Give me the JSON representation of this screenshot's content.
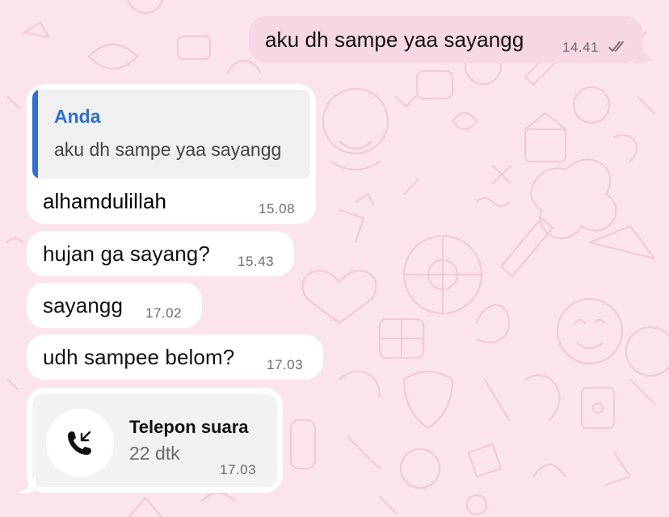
{
  "colors": {
    "background": "#fbe4ec",
    "incoming_bubble": "#ffffff",
    "outgoing_bubble": "#f7d7e4",
    "quote_accent": "#2f6fd0",
    "timestamp": "#6b6b6b"
  },
  "messages": {
    "outgoing_1": {
      "text": "aku dh sampe yaa sayangg",
      "time": "14.41",
      "status_icon": "double-check-icon"
    },
    "reply": {
      "quote_author": "Anda",
      "quote_text": "aku dh sampe yaa sayangg",
      "text": "alhamdulillah",
      "time": "15.08"
    },
    "incoming_2": {
      "text": "hujan ga sayang?",
      "time": "15.43"
    },
    "incoming_3": {
      "text": "sayangg",
      "time": "17.02"
    },
    "incoming_4": {
      "text": "udh sampee belom?",
      "time": "17.03"
    }
  },
  "call": {
    "icon": "incoming-call-icon",
    "title": "Telepon suara",
    "duration": "22 dtk",
    "time": "17.03"
  }
}
